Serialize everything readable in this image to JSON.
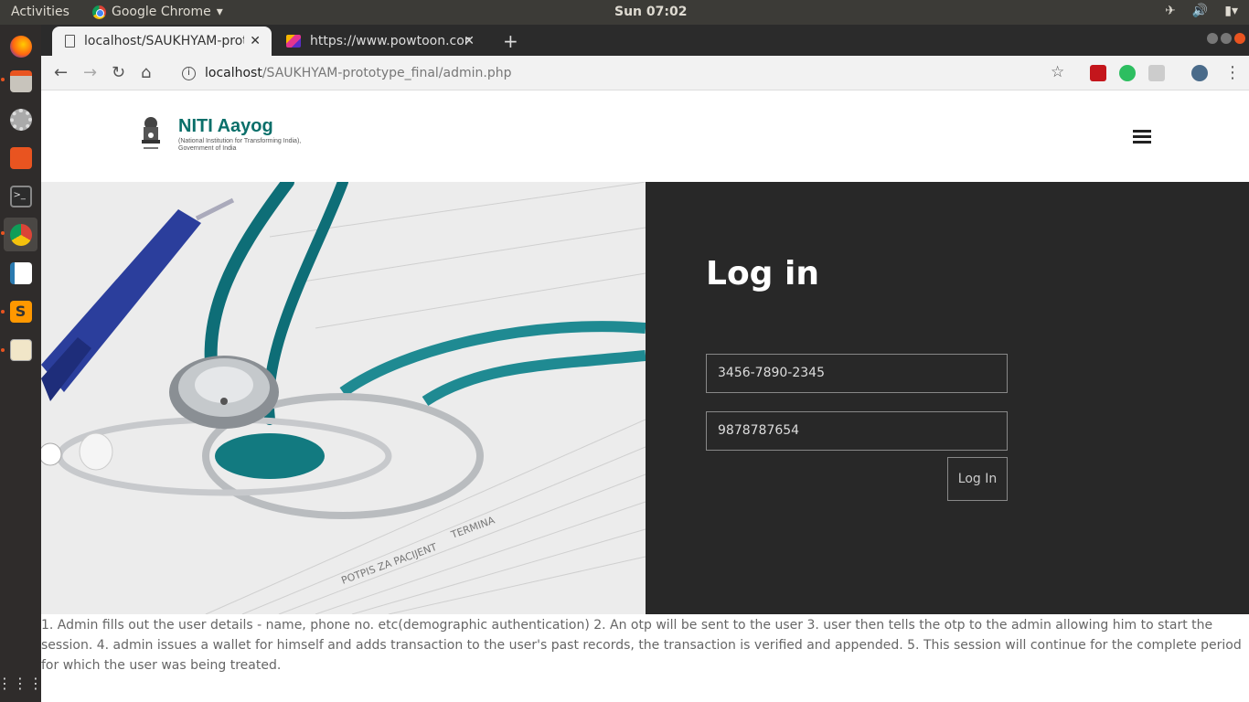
{
  "system": {
    "activities": "Activities",
    "app_name": "Google Chrome",
    "clock": "Sun 07:02"
  },
  "browser": {
    "tabs": [
      {
        "title": "localhost/SAUKHYAM-prototype_final/admin.php",
        "active": true
      },
      {
        "title": "https://www.powtoon.com",
        "active": false
      }
    ],
    "url_host": "localhost",
    "url_path": "/SAUKHYAM-prototype_final/admin.php"
  },
  "site": {
    "brand_title": "NITI Aayog",
    "brand_subtitle_line1": "(National Institution for Transforming India),",
    "brand_subtitle_line2": "Government of India"
  },
  "login": {
    "heading": "Log in",
    "field1_value": "3456-7890-2345",
    "field2_value": "9878787654",
    "button_label": "Log In"
  },
  "description": "1. Admin fills out the user details - name, phone no. etc(demographic authentication) 2. An otp will be sent to the user 3. user then tells the otp to the admin allowing him to start the session. 4. admin issues a wallet for himself and adds transaction to the user's past records, the transaction is verified and appended. 5. This session will continue for the complete period for which the user was being treated."
}
